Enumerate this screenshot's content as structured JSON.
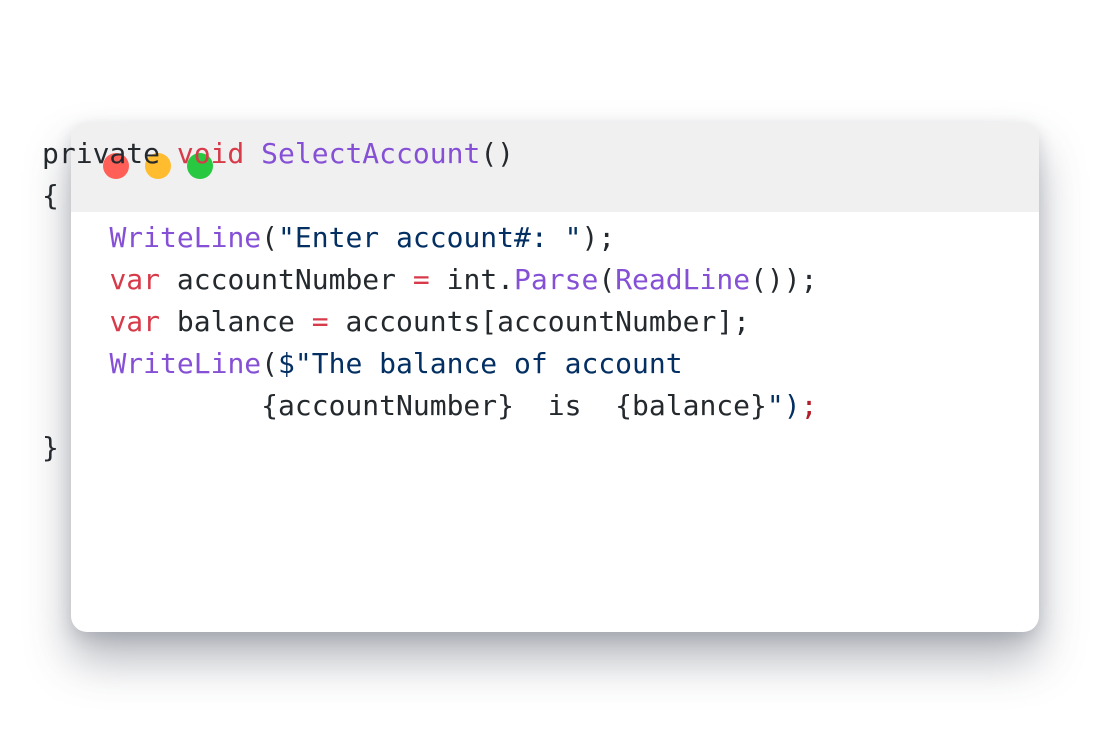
{
  "window": {
    "controls": [
      {
        "name": "close",
        "color": "#ff5f57"
      },
      {
        "name": "minimize",
        "color": "#febc2e"
      },
      {
        "name": "maximize",
        "color": "#28c840"
      }
    ]
  },
  "code": {
    "language": "csharp",
    "lines": [
      [
        {
          "text": "private ",
          "token": "plain"
        },
        {
          "text": "void",
          "token": "keyword"
        },
        {
          "text": " ",
          "token": "plain"
        },
        {
          "text": "SelectAccount",
          "token": "function"
        },
        {
          "text": "()",
          "token": "plain"
        }
      ],
      [
        {
          "text": "{",
          "token": "plain"
        }
      ],
      [
        {
          "text": "    ",
          "token": "plain"
        },
        {
          "text": "WriteLine",
          "token": "function"
        },
        {
          "text": "(",
          "token": "plain"
        },
        {
          "text": "\"Enter account#: \"",
          "token": "string"
        },
        {
          "text": ");",
          "token": "plain"
        }
      ],
      [
        {
          "text": "    ",
          "token": "plain"
        },
        {
          "text": "var",
          "token": "keyword"
        },
        {
          "text": " accountNumber ",
          "token": "plain"
        },
        {
          "text": "=",
          "token": "keyword"
        },
        {
          "text": " int.",
          "token": "plain"
        },
        {
          "text": "Parse",
          "token": "function"
        },
        {
          "text": "(",
          "token": "plain"
        },
        {
          "text": "ReadLine",
          "token": "function"
        },
        {
          "text": "());",
          "token": "plain"
        }
      ],
      [
        {
          "text": "    ",
          "token": "plain"
        },
        {
          "text": "var",
          "token": "keyword"
        },
        {
          "text": " balance ",
          "token": "plain"
        },
        {
          "text": "=",
          "token": "keyword"
        },
        {
          "text": " accounts[accountNumber];",
          "token": "plain"
        }
      ],
      [
        {
          "text": "    ",
          "token": "plain"
        },
        {
          "text": "WriteLine",
          "token": "function"
        },
        {
          "text": "(",
          "token": "plain"
        },
        {
          "text": "$\"The balance of account",
          "token": "string"
        }
      ],
      [
        {
          "text": "             {accountNumber}  is  {balance}",
          "token": "plain"
        },
        {
          "text": "\")",
          "token": "string"
        },
        {
          "text": ";",
          "token": "accent"
        }
      ],
      [
        {
          "text": "}",
          "token": "plain"
        }
      ]
    ]
  }
}
